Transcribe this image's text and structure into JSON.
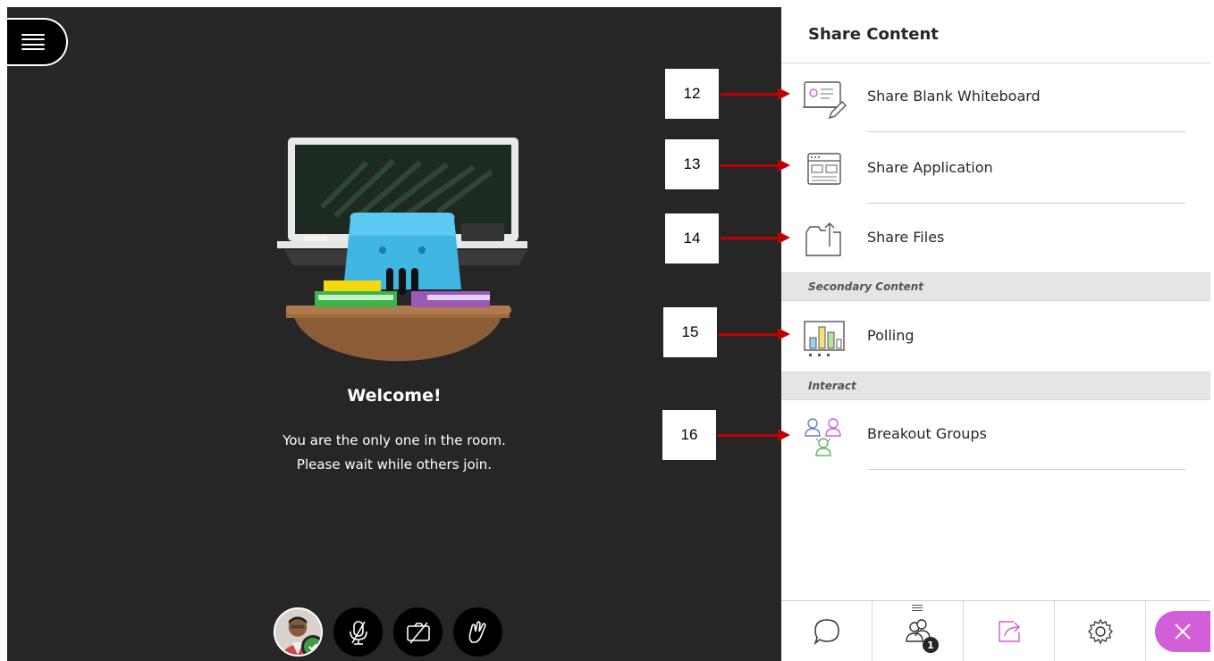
{
  "stage": {
    "welcome_title": "Welcome!",
    "welcome_line_1": "You are the only one in the room.",
    "welcome_line_2": "Please wait while others join.",
    "icons": {
      "menu": "hamburger-menu-icon",
      "mic": "microphone-muted-icon",
      "camera": "camera-off-icon",
      "hand": "raise-hand-icon"
    }
  },
  "panel": {
    "title": "Share Content",
    "items": [
      {
        "label": "Share Blank Whiteboard",
        "icon": "whiteboard-icon"
      },
      {
        "label": "Share Application",
        "icon": "application-window-icon"
      },
      {
        "label": "Share Files",
        "icon": "folder-share-icon"
      },
      {
        "label": "Polling",
        "icon": "poll-chart-icon"
      },
      {
        "label": "Breakout Groups",
        "icon": "breakout-groups-icon"
      }
    ],
    "sections": {
      "secondary": "Secondary Content",
      "interact": "Interact"
    },
    "bottom_tabs": {
      "chat": "chat-icon",
      "attendees": "attendees-icon",
      "attendee_count": "1",
      "share": "share-content-icon",
      "settings": "gear-icon",
      "close": "close-icon"
    },
    "accent_color": "#d35fd8"
  },
  "callouts": [
    "12",
    "13",
    "14",
    "15",
    "16"
  ]
}
